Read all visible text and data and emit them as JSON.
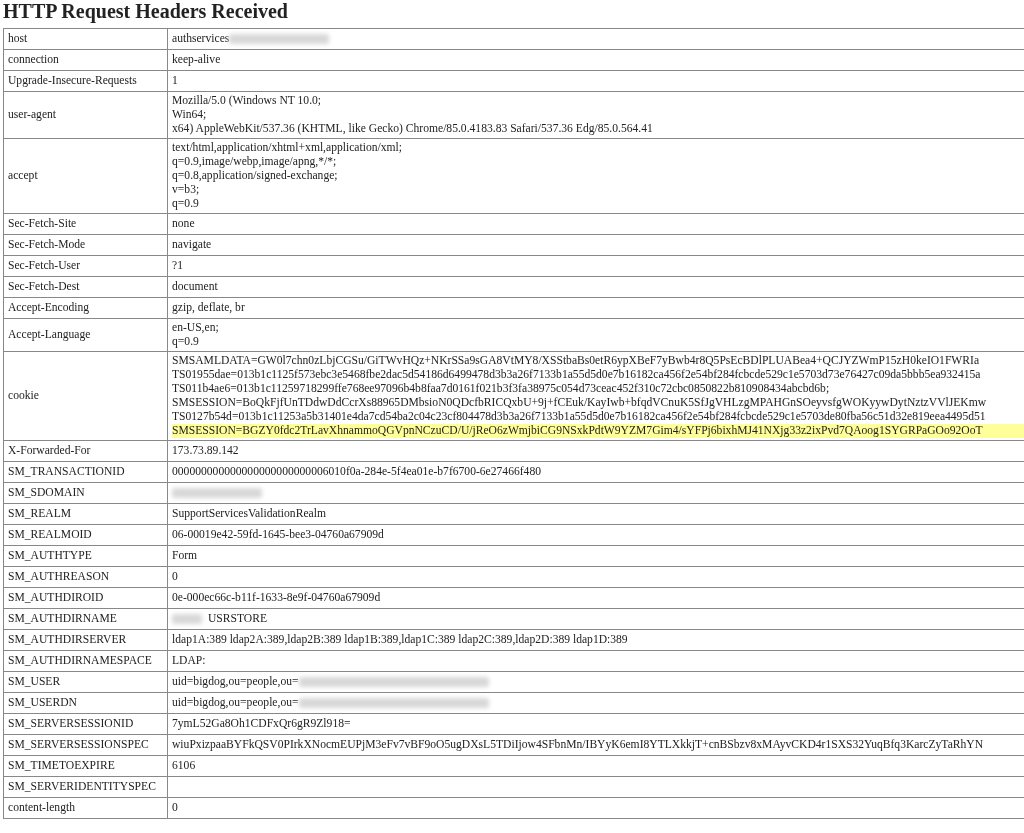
{
  "title": "HTTP Request Headers Received",
  "headers": [
    {
      "name": "host",
      "lines": [
        "authservices"
      ],
      "blur_after": true
    },
    {
      "name": "connection",
      "lines": [
        "keep-alive"
      ]
    },
    {
      "name": "Upgrade-Insecure-Requests",
      "lines": [
        "1"
      ]
    },
    {
      "name": "user-agent",
      "lines": [
        "Mozilla/5.0 (Windows NT 10.0;",
        "Win64;",
        "x64) AppleWebKit/537.36 (KHTML, like Gecko) Chrome/85.0.4183.83 Safari/537.36 Edg/85.0.564.41"
      ]
    },
    {
      "name": "accept",
      "lines": [
        "text/html,application/xhtml+xml,application/xml;",
        "q=0.9,image/webp,image/apng,*/*;",
        "q=0.8,application/signed-exchange;",
        "v=b3;",
        "q=0.9"
      ]
    },
    {
      "name": "Sec-Fetch-Site",
      "lines": [
        "none"
      ]
    },
    {
      "name": "Sec-Fetch-Mode",
      "lines": [
        "navigate"
      ]
    },
    {
      "name": "Sec-Fetch-User",
      "lines": [
        "?1"
      ]
    },
    {
      "name": "Sec-Fetch-Dest",
      "lines": [
        "document"
      ]
    },
    {
      "name": "Accept-Encoding",
      "lines": [
        "gzip, deflate, br"
      ]
    },
    {
      "name": "Accept-Language",
      "lines": [
        "en-US,en;",
        "q=0.9"
      ]
    },
    {
      "name": "cookie",
      "lines": [
        {
          "text": "SMSAMLDATA=GW0l7chn0zLbjCGSu/GiTWvHQz+NKrSSa9sGA8VtMY8/XSStbaBs0etR6ypXBeF7yBwb4r8Q5PsEcBDlPLUABea4+QCJYZWmP15zH0keIO1FWRIa",
          "highlighted": false
        },
        {
          "text": "TS01955dae=013b1c1125f573ebc3e5468fbe2dac5d54186d6499478d3b3a26f7133b1a55d5d0e7b16182ca456f2e54bf284fcbcde529c1e5703d73e76427c09da5bbb5ea932415a",
          "highlighted": false
        },
        {
          "text": "TS011b4ae6=013b1c11259718299ffe768ee97096b4b8faa7d0161f021b3f3fa38975c054d73ceac452f310c72cbc0850822b810908434abcbd6b;",
          "highlighted": false
        },
        {
          "text": "SMSESSION=BoQkFjfUnTDdwDdCcrXs88965DMbsioN0QDcfbRICQxbU+9j+fCEuk/KayIwb+bfqdVCnuK5SfJgVHLzgMPAHGnSOeyvsfgWOKyywDytNztzVVlJEKmw",
          "highlighted": false
        },
        {
          "text": "TS0127b54d=013b1c11253a5b31401e4da7cd54ba2c04c23cf804478d3b3a26f7133b1a55d5d0e7b16182ca456f2e54bf284fcbcde529c1e5703de80fba56c51d32e819eea4495d51",
          "highlighted": false
        },
        {
          "text": "SMSESSION=BGZY0fdc2TrLavXhnammoQGVpnNCzuCD/U/jReO6zWmjbiCG9NSxkPdtW9YZM7Gim4/sYFPj6bixhMJ41NXjg33z2ixPvd7QAoog1SYGRPaGOo92OoT",
          "highlighted": true
        }
      ]
    },
    {
      "name": "X-Forwarded-For",
      "lines": [
        "173.73.89.142"
      ]
    },
    {
      "name": "SM_TRANSACTIONID",
      "lines": [
        "000000000000000000000000006010f0a-284e-5f4ea01e-b7f6700-6e27466f480"
      ]
    },
    {
      "name": "SM_SDOMAIN",
      "blur_before": true
    },
    {
      "name": "SM_REALM",
      "lines": [
        "SupportServicesValidationRealm"
      ]
    },
    {
      "name": "SM_REALMOID",
      "lines": [
        "06-00019e42-59fd-1645-bee3-04760a67909d"
      ]
    },
    {
      "name": "SM_AUTHTYPE",
      "lines": [
        "Form"
      ]
    },
    {
      "name": "SM_AUTHREASON",
      "lines": [
        "0"
      ]
    },
    {
      "name": "SM_AUTHDIROID",
      "lines": [
        "0e-000ec66c-b11f-1633-8e9f-04760a67909d"
      ]
    },
    {
      "name": "SM_AUTHDIRNAME",
      "lines": [
        "USRSTORE"
      ],
      "blur_before": true
    },
    {
      "name": "SM_AUTHDIRSERVER",
      "lines": [
        "ldap1A:389 ldap2A:389,ldap2B:389 ldap1B:389,ldap1C:389 ldap2C:389,ldap2D:389 ldap1D:389"
      ]
    },
    {
      "name": "SM_AUTHDIRNAMESPACE",
      "lines": [
        "LDAP:"
      ]
    },
    {
      "name": "SM_USER",
      "lines": [
        "uid=bigdog,ou=people,ou="
      ],
      "blur_after": true
    },
    {
      "name": "SM_USERDN",
      "lines": [
        "uid=bigdog,ou=people,ou="
      ],
      "blur_after": true
    },
    {
      "name": "SM_SERVERSESSIONID",
      "lines": [
        "7ymL52Ga8Oh1CDFxQr6gR9Zl918="
      ]
    },
    {
      "name": "SM_SERVERSESSIONSPEC",
      "lines": [
        "wiuPxizpaaBYFkQSV0PIrkXNocmEUPjM3eFv7vBF9oO5ugDXsL5TDiIjow4SFbnMn/IBYyK6emI8YTLXkkjT+cnBSbzv8xMAyvCKD4r1SXS32YuqBfq3KarcZyTaRhYN"
      ]
    },
    {
      "name": "SM_TIMETOEXPIRE",
      "lines": [
        "6106"
      ]
    },
    {
      "name": "SM_SERVERIDENTITYSPEC"
    },
    {
      "name": "content-length",
      "lines": [
        "0"
      ]
    }
  ]
}
